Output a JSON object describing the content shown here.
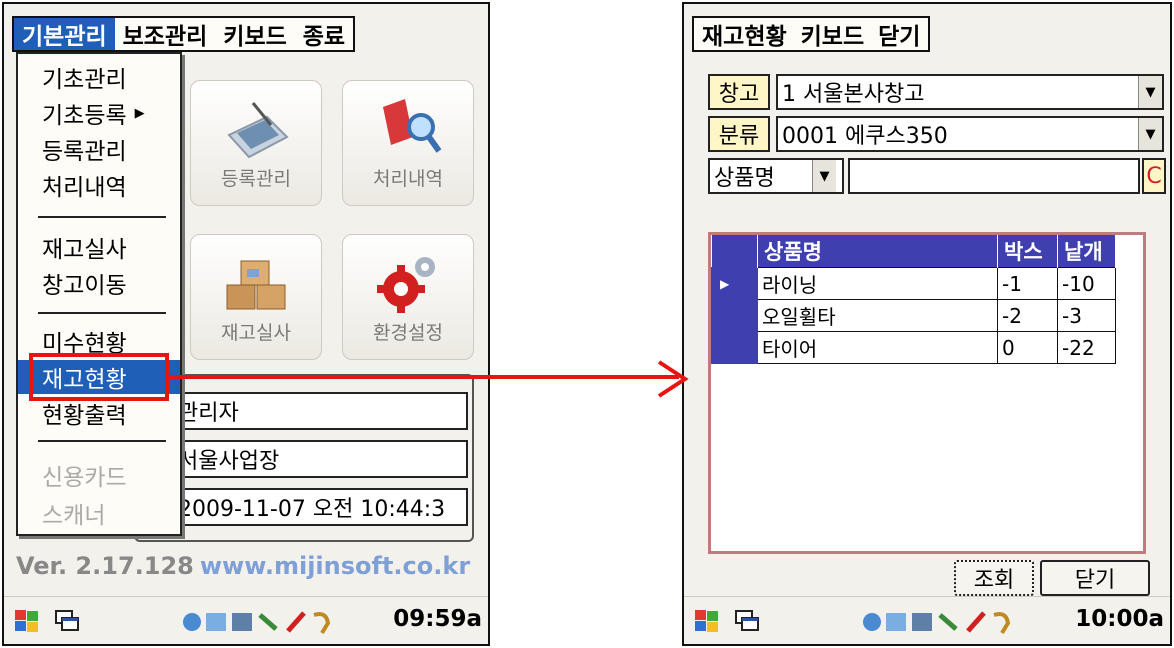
{
  "left_screen": {
    "menubar": [
      "기본관리",
      "보조관리",
      "키보드",
      "종료"
    ],
    "tiles": [
      {
        "label": "등록관리",
        "icon": "tablet-icon"
      },
      {
        "label": "처리내역",
        "icon": "magnifier-icon"
      },
      {
        "label": "재고실사",
        "icon": "boxes-icon"
      },
      {
        "label": "환경설정",
        "icon": "gears-icon"
      }
    ],
    "fields": [
      "관리자",
      "서울사업장",
      "2009-11-07 오전 10:44:3"
    ],
    "version_label": "Ver. 2.17.128",
    "website": "www.mijinsoft.co.kr",
    "dropdown": {
      "items": [
        {
          "label": "기초관리"
        },
        {
          "label": "기초등록"
        },
        {
          "label": "등록관리"
        },
        {
          "label": "처리내역"
        },
        {
          "label": "재고실사"
        },
        {
          "label": "창고이동"
        },
        {
          "label": "미수현황"
        },
        {
          "label": "재고현황"
        },
        {
          "label": "현황출력"
        },
        {
          "label": "신용카드"
        },
        {
          "label": "스캐너"
        }
      ],
      "submenu_arrow": "▶"
    },
    "clock": "09:59a"
  },
  "right_screen": {
    "menubar": [
      "재고현황",
      "키보드",
      "닫기"
    ],
    "warehouse_label": "창고",
    "warehouse_value": "1 서울본사창고",
    "category_label": "분류",
    "category_value": "0001 에쿠스350",
    "search_field_value": "상품명",
    "search_input_value": "",
    "clear_label": "C",
    "table": {
      "headers": [
        "상품명",
        "박스",
        "낱개"
      ],
      "rows": [
        [
          "라이닝",
          "-1",
          "-10"
        ],
        [
          "오일휠타",
          "-2",
          "-3"
        ],
        [
          "타이어",
          "0",
          "-22"
        ]
      ]
    },
    "query_button": "조회",
    "close_button": "닫기",
    "clock": "10:00a"
  },
  "colors": {
    "menu_highlight": "#1f5fb8",
    "grid_header": "#3f3fb0",
    "annotation": "#e8140f",
    "label_bg": "#fff6c8"
  }
}
